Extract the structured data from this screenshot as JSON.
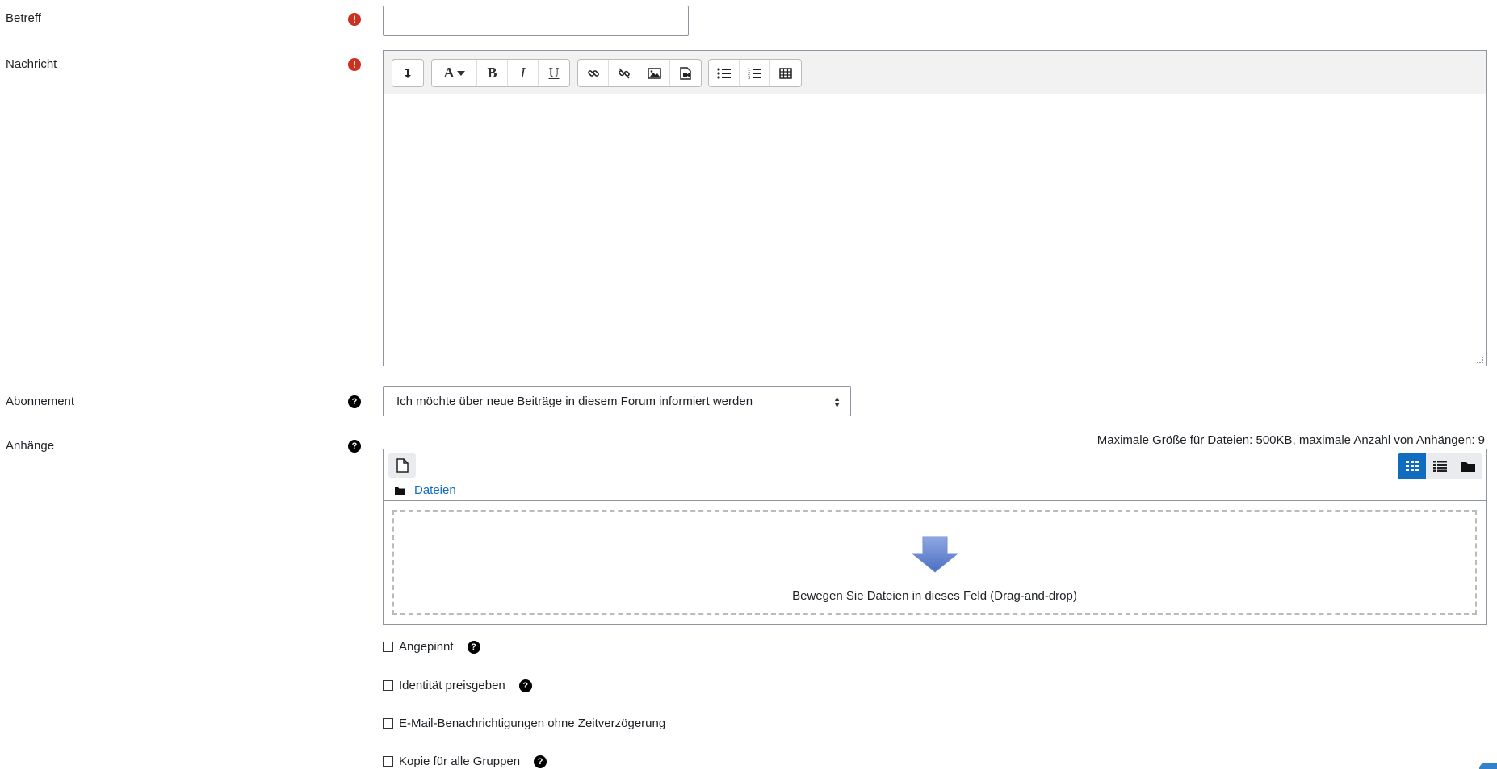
{
  "form": {
    "subject": {
      "label": "Betreff",
      "value": ""
    },
    "message": {
      "label": "Nachricht"
    },
    "subscription": {
      "label": "Abonnement",
      "selected": "Ich möchte über neue Beiträge in diesem Forum informiert werden"
    },
    "attachments": {
      "label": "Anhänge",
      "max_size_text": "Maximale Größe für Dateien: 500KB, maximale Anzahl von Anhängen: 9",
      "path_label": "Dateien",
      "dropzone_text": "Bewegen Sie Dateien in dieses Feld (Drag-and-drop)"
    },
    "checkboxes": [
      {
        "label": "Angepinnt",
        "has_help": true
      },
      {
        "label": "Identität preisgeben",
        "has_help": true
      },
      {
        "label": "E-Mail-Benachrichtigungen ohne Zeitverzögerung",
        "has_help": false
      },
      {
        "label": "Kopie für alle Gruppen",
        "has_help": true
      }
    ]
  },
  "editor_toolbar": {
    "groups": [
      [
        "collapse-icon"
      ],
      [
        "font-style-icon",
        "bold-icon",
        "italic-icon",
        "underline-icon"
      ],
      [
        "link-icon",
        "unlink-icon",
        "image-icon",
        "media-icon"
      ],
      [
        "unordered-list-icon",
        "ordered-list-icon",
        "table-icon"
      ]
    ]
  },
  "icons": {
    "required": "exclamation-circle-icon",
    "help": "question-circle-icon"
  },
  "colors": {
    "required": "#ca3120",
    "link": "#0f6cbf",
    "border": "#8f959e",
    "toolbar_bg": "#f2f2f2"
  }
}
